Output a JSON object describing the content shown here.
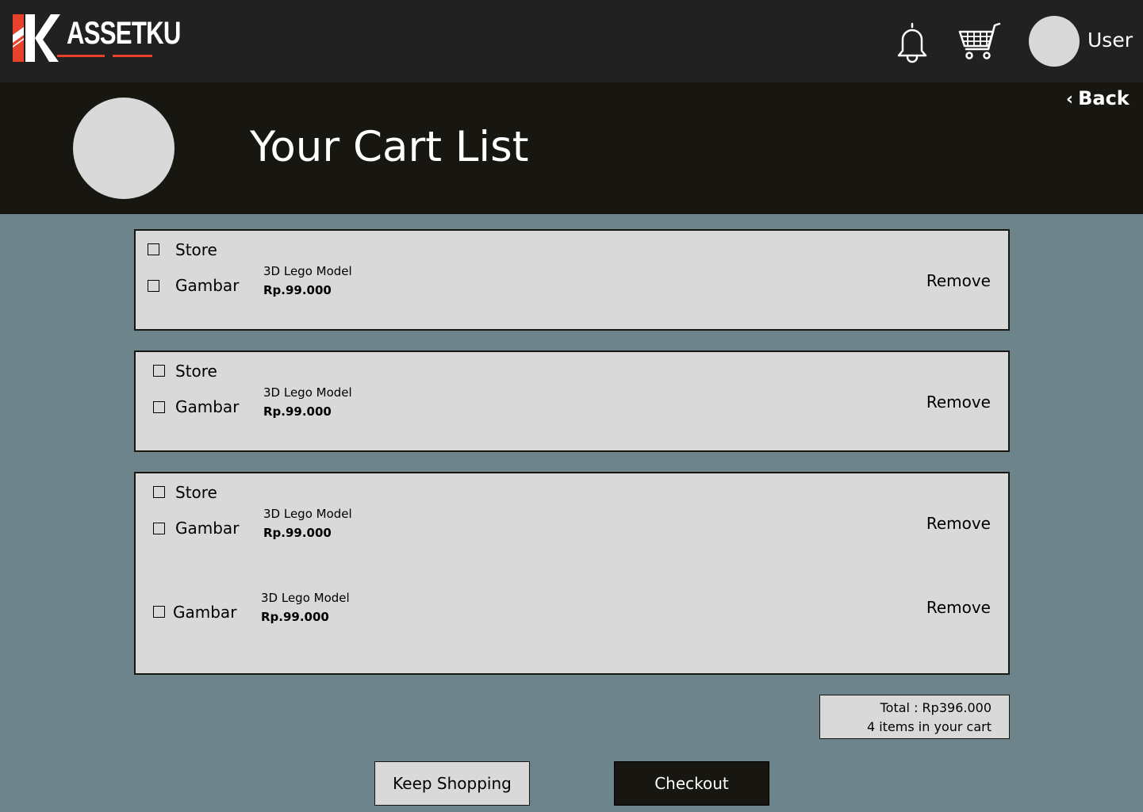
{
  "header": {
    "logo_mark": "K",
    "logo_text": "ASSETKU",
    "user_name": "User"
  },
  "hero": {
    "title": "Your Cart List",
    "back_label": "Back"
  },
  "cart": {
    "groups": [
      {
        "store_label": "Store",
        "items": [
          {
            "image_label": "Gambar",
            "name": "3D Lego Model",
            "price": "Rp.99.000",
            "remove_label": "Remove"
          }
        ]
      },
      {
        "store_label": "Store",
        "items": [
          {
            "image_label": "Gambar",
            "name": "3D Lego Model",
            "price": "Rp.99.000",
            "remove_label": "Remove"
          }
        ]
      },
      {
        "store_label": "Store",
        "items": [
          {
            "image_label": "Gambar",
            "name": "3D Lego Model",
            "price": "Rp.99.000",
            "remove_label": "Remove"
          },
          {
            "image_label": "Gambar",
            "name": "3D Lego Model",
            "price": "Rp.99.000",
            "remove_label": "Remove"
          }
        ]
      }
    ]
  },
  "summary": {
    "total": "Total : Rp396.000",
    "count": "4 items in your cart"
  },
  "actions": {
    "keep_shopping": "Keep Shopping",
    "checkout": "Checkout"
  },
  "colors": {
    "page_bg": "#6d848b",
    "topbar_bg": "#212121",
    "hero_bg": "#171611",
    "card_bg": "#d9d9d9",
    "logo_accent": "#e8412c"
  }
}
